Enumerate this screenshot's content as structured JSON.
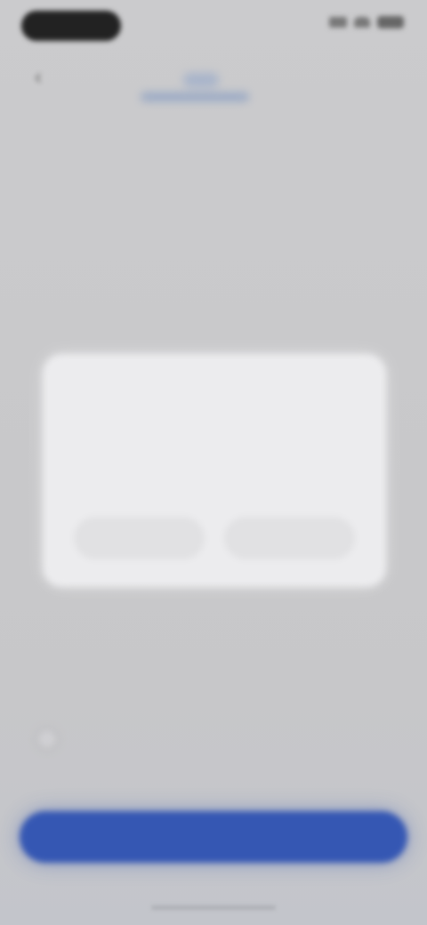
{
  "status_bar": {
    "time": "",
    "icons": [
      "signal-icon",
      "wifi-icon",
      "battery-icon"
    ]
  },
  "header": {
    "back_icon": "chevron-left-icon",
    "back_glyph": "‹",
    "logo_text": ""
  },
  "content": {
    "headline": "",
    "subtitle": ""
  },
  "dialog": {
    "title": "",
    "body": "",
    "secondary_button": "",
    "primary_button": ""
  },
  "consent": {
    "text": ""
  },
  "cta": {
    "label": ""
  },
  "colors": {
    "background": "#c9c9cb",
    "dialog": "#ececee",
    "cta": "#3557b3"
  }
}
